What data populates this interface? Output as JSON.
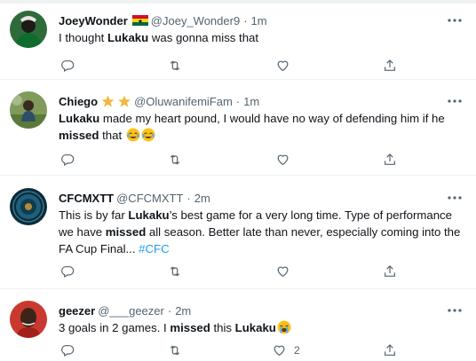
{
  "colors": {
    "text": "#0f1419",
    "secondary": "#536471",
    "link": "#1d9bf0",
    "divider": "#eff3f4"
  },
  "tweets": [
    {
      "name": "JoeyWonder",
      "handle": "@Joey_Wonder9",
      "dot": "·",
      "time": "1m",
      "badge": "ghana-flag",
      "text_parts": [
        "I thought ",
        "Lukaku",
        " was gonna miss that"
      ],
      "like_count": ""
    },
    {
      "name": "Chiego",
      "handle": "@OluwanifemiFam",
      "dot": "·",
      "time": "1m",
      "badge": "two-stars",
      "text_parts": [
        "Lukaku",
        " made my heart pound, I would have no way of defending him if he ",
        "missed",
        " that "
      ],
      "emoji": "joy-emoji",
      "like_count": ""
    },
    {
      "name": "CFCMXTT",
      "handle": "@CFCMXTT",
      "dot": "·",
      "time": "2m",
      "text_parts": [
        "This is by far ",
        "Lukaku",
        "’s best game for a very long time. Type of performance we have ",
        "missed",
        " all season. Better late than never, especially coming into the FA Cup Final... ",
        "#CFC"
      ],
      "like_count": ""
    },
    {
      "name": "geezer",
      "handle": "@___geezer",
      "dot": "·",
      "time": "2m",
      "text_parts": [
        "3 goals in 2 games. I ",
        "missed",
        " this ",
        "Lukaku"
      ],
      "emoji": "sob-emoji",
      "like_count": "2"
    }
  ],
  "icons": {
    "reply": "reply-icon",
    "retweet": "retweet-icon",
    "like": "heart-icon",
    "share": "share-icon",
    "more": "more-icon"
  }
}
